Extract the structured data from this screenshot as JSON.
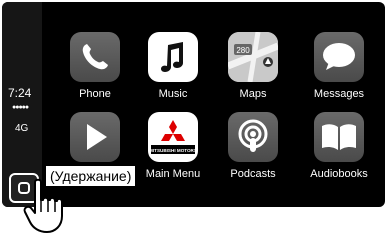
{
  "status": {
    "time": "7:24",
    "signal": "●●●●●",
    "network": "4G"
  },
  "apps": [
    {
      "label": "Phone"
    },
    {
      "label": "Music"
    },
    {
      "label": "Maps",
      "badge": "280"
    },
    {
      "label": "Messages"
    },
    {
      "label": ""
    },
    {
      "label": "Main Menu",
      "icon_text": "MITSUBISHI MOTORS"
    },
    {
      "label": "Podcasts"
    },
    {
      "label": "Audiobooks"
    }
  ],
  "callout": {
    "text": "(Удержание)"
  }
}
